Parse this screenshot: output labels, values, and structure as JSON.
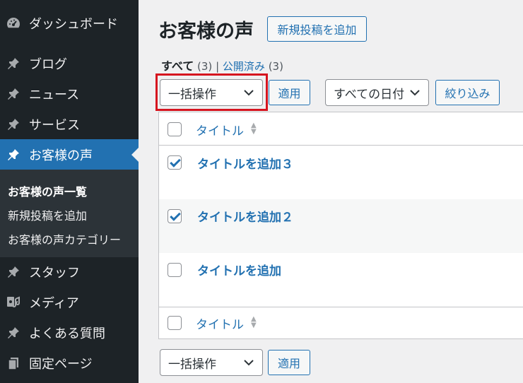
{
  "sidebar": {
    "items": [
      {
        "label": "ダッシュボード",
        "icon": "dashboard-icon"
      },
      {
        "label": "ブログ",
        "icon": "pin-icon"
      },
      {
        "label": "ニュース",
        "icon": "pin-icon"
      },
      {
        "label": "サービス",
        "icon": "pin-icon"
      },
      {
        "label": "お客様の声",
        "icon": "pin-icon"
      },
      {
        "label": "スタッフ",
        "icon": "pin-icon"
      },
      {
        "label": "メディア",
        "icon": "media-icon"
      },
      {
        "label": "よくある質問",
        "icon": "pin-icon"
      },
      {
        "label": "固定ページ",
        "icon": "page-icon"
      }
    ],
    "submenu": [
      "お客様の声一覧",
      "新規投稿を追加",
      "お客様の声カテゴリー"
    ]
  },
  "main": {
    "title": "お客様の声",
    "add_new": "新規投稿を追加",
    "filters": {
      "all": "すべて",
      "all_count": "(3)",
      "sep": "|",
      "published": "公開済み",
      "published_count": "(3)"
    },
    "bulk_select": "一括操作",
    "apply": "適用",
    "date_select": "すべての日付",
    "filter_btn": "絞り込み",
    "column_title": "タイトル",
    "posts": [
      {
        "title": "タイトルを追加３",
        "checked": true
      },
      {
        "title": "タイトルを追加２",
        "checked": true
      },
      {
        "title": "タイトルを追加",
        "checked": false
      }
    ]
  },
  "colors": {
    "sidebar_bg": "#1d2327",
    "accent": "#2271b1",
    "highlight": "#d6141f"
  }
}
